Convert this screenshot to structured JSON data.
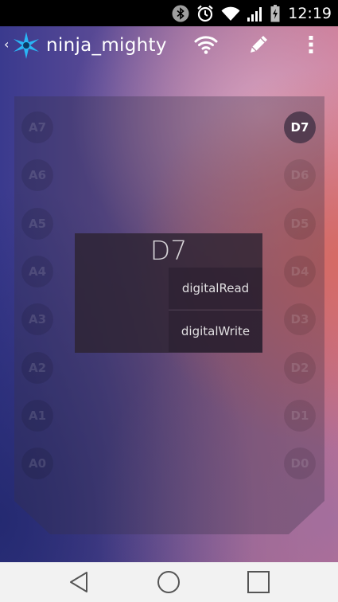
{
  "status_bar": {
    "time": "12:19",
    "icons": [
      "bluetooth-icon",
      "alarm-icon",
      "wifi-icon",
      "signal-icon",
      "battery-charging-icon"
    ]
  },
  "action_bar": {
    "title": "ninja_mighty",
    "back_glyph": "‹",
    "icons": [
      "wifi-icon",
      "pencil-icon",
      "overflow-menu-icon"
    ]
  },
  "board": {
    "left_pins": [
      "A7",
      "A6",
      "A5",
      "A4",
      "A3",
      "A2",
      "A1",
      "A0"
    ],
    "right_pins": [
      "D7",
      "D6",
      "D5",
      "D4",
      "D3",
      "D2",
      "D1",
      "D0"
    ],
    "active_pin": "D7"
  },
  "popup": {
    "title": "D7",
    "options": [
      "digitalRead",
      "digitalWrite"
    ]
  },
  "nav_bar": {
    "icons": [
      "back-triangle-icon",
      "home-circle-icon",
      "recents-square-icon"
    ]
  },
  "colors": {
    "accent_logo": "#29b6f6",
    "active_pin_bg": "#4b374b",
    "nav_bg": "#f2f2f2"
  }
}
